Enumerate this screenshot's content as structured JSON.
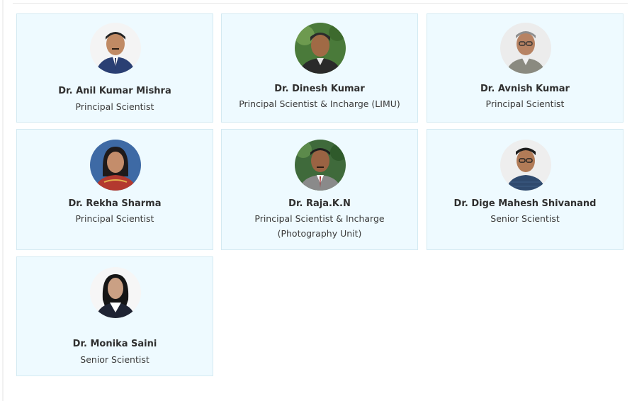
{
  "people": [
    {
      "name": "Dr. Anil Kumar Mishra",
      "designation": "Principal Scientist",
      "photo_icon": "person-portrait-icon"
    },
    {
      "name": "Dr. Dinesh Kumar",
      "designation": "Principal Scientist & Incharge (LIMU)",
      "photo_icon": "person-portrait-icon"
    },
    {
      "name": "Dr. Avnish Kumar",
      "designation": "Principal Scientist",
      "photo_icon": "person-portrait-icon"
    },
    {
      "name": "Dr. Rekha Sharma",
      "designation": "Principal Scientist",
      "photo_icon": "person-portrait-icon"
    },
    {
      "name": "Dr. Raja.K.N",
      "designation": "Principal Scientist & Incharge",
      "designation_line2": "(Photography Unit)",
      "photo_icon": "person-portrait-icon"
    },
    {
      "name": "Dr. Dige Mahesh Shivanand",
      "designation": "Senior Scientist",
      "photo_icon": "person-portrait-icon"
    },
    {
      "name": "Dr. Monika Saini",
      "designation": "Senior Scientist",
      "photo_icon": "person-portrait-icon"
    }
  ],
  "colors": {
    "card_bg": "#eefaff",
    "card_border": "#d4eaf2",
    "name_text": "#2f2f2f"
  }
}
